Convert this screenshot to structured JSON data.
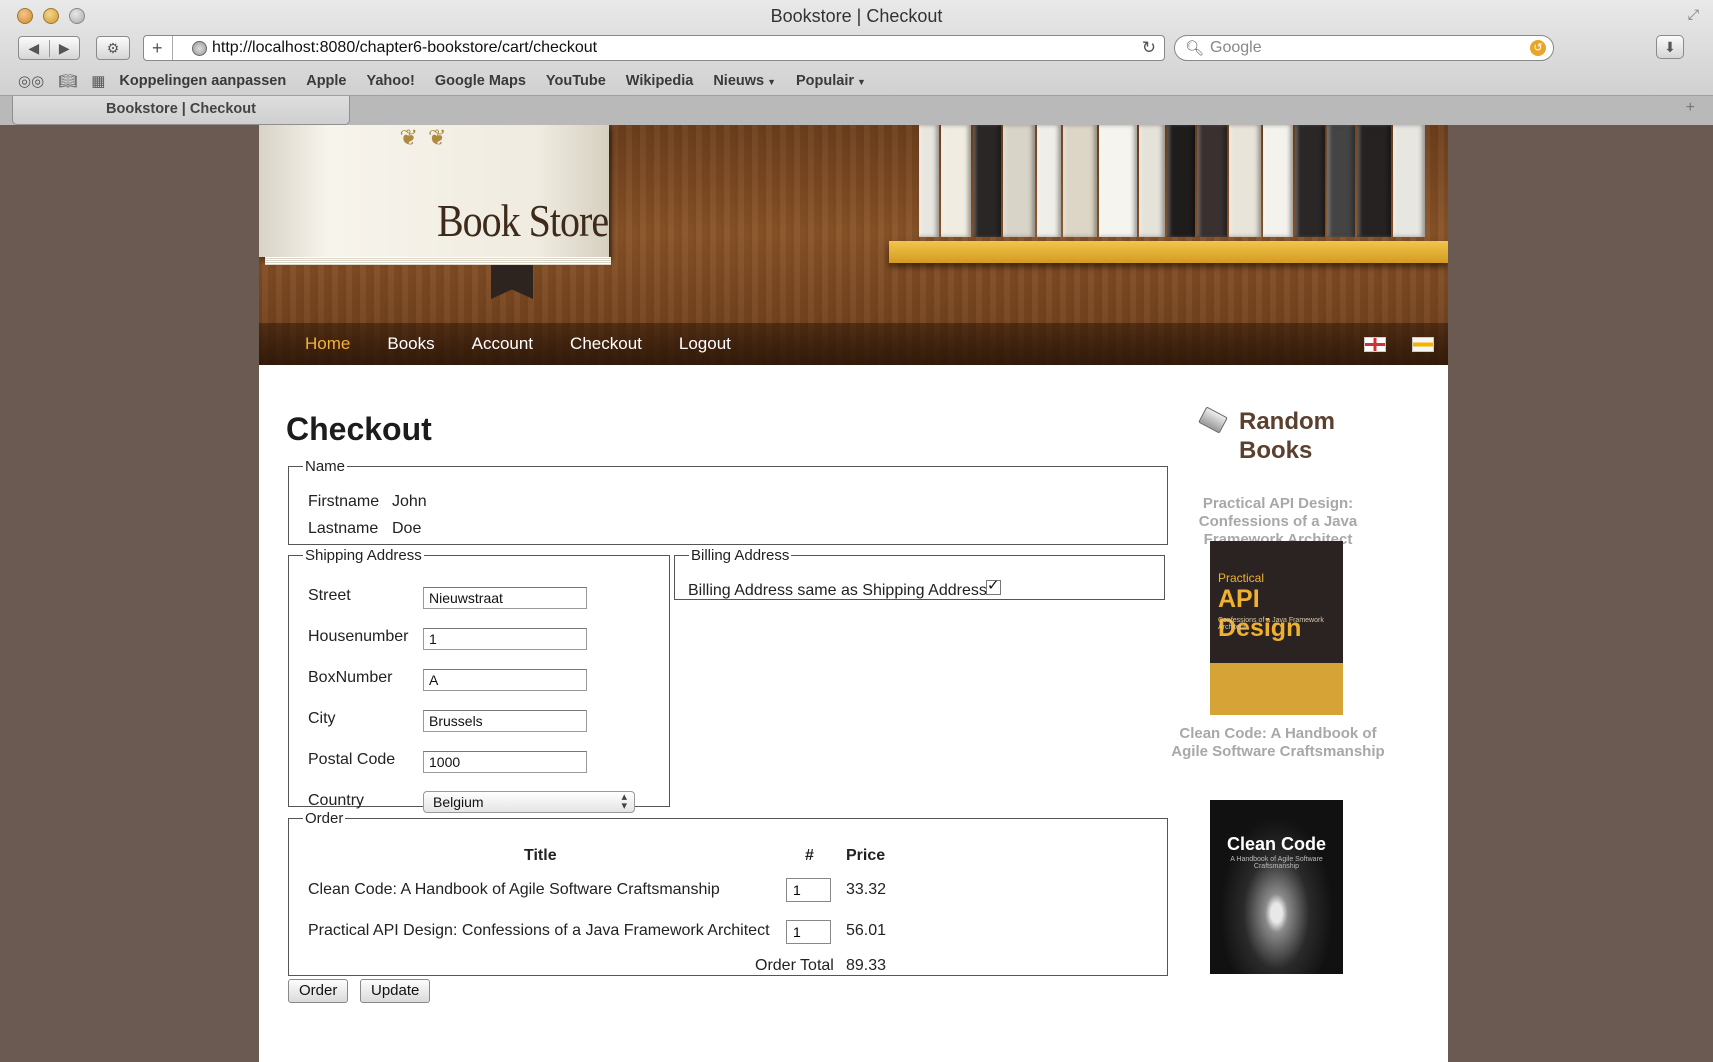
{
  "browser": {
    "window_title": "Bookstore | Checkout",
    "address": "http://localhost:8080/chapter6-bookstore/cart/checkout",
    "search_placeholder": "Google",
    "bookmarks": [
      "Koppelingen aanpassen",
      "Apple",
      "Yahoo!",
      "Google Maps",
      "YouTube",
      "Wikipedia",
      "Nieuws",
      "Populair"
    ],
    "tab_title": "Bookstore | Checkout"
  },
  "banner": {
    "store_name": "Book Store"
  },
  "nav": {
    "items": [
      "Home",
      "Books",
      "Account",
      "Checkout",
      "Logout"
    ],
    "active": "Home"
  },
  "checkout": {
    "title": "Checkout",
    "name_section": {
      "legend": "Name",
      "firstname_label": "Firstname",
      "firstname": "John",
      "lastname_label": "Lastname",
      "lastname": "Doe"
    },
    "shipping": {
      "legend": "Shipping Address",
      "fields": [
        {
          "label": "Street",
          "value": "Nieuwstraat"
        },
        {
          "label": "Housenumber",
          "value": "1"
        },
        {
          "label": "BoxNumber",
          "value": "A"
        },
        {
          "label": "City",
          "value": "Brussels"
        },
        {
          "label": "Postal Code",
          "value": "1000"
        }
      ],
      "country_label": "Country",
      "country": "Belgium"
    },
    "billing": {
      "legend": "Billing Address",
      "same_label": "Billing Address same as Shipping Address",
      "same_checked": true
    },
    "order": {
      "legend": "Order",
      "headers": {
        "title": "Title",
        "qty": "#",
        "price": "Price"
      },
      "rows": [
        {
          "title": "Clean Code: A Handbook of Agile Software Craftsmanship",
          "qty": "1",
          "price": "33.32"
        },
        {
          "title": "Practical API Design: Confessions of a Java Framework Architect",
          "qty": "1",
          "price": "56.01"
        }
      ],
      "total_label": "Order Total",
      "total": "89.33"
    },
    "buttons": {
      "order": "Order",
      "update": "Update"
    }
  },
  "sidebar": {
    "title_line1": "Random",
    "title_line2": "Books",
    "books": [
      {
        "title": "Practical API Design: Confessions of a Java Framework Architect",
        "cover_line1": "Practical",
        "cover_line2": "API Design",
        "cover_line3": "Confessions of a Java Framework Architect"
      },
      {
        "title": "Clean Code: A Handbook of Agile Software Craftsmanship",
        "cover_line1": "Clean Code",
        "cover_line2": "A Handbook of Agile Software Craftsmanship"
      }
    ]
  },
  "colors": {
    "nav_active": "#f4b23a",
    "sidebar_title": "#5b4030",
    "page_background": "#6b5a52"
  }
}
